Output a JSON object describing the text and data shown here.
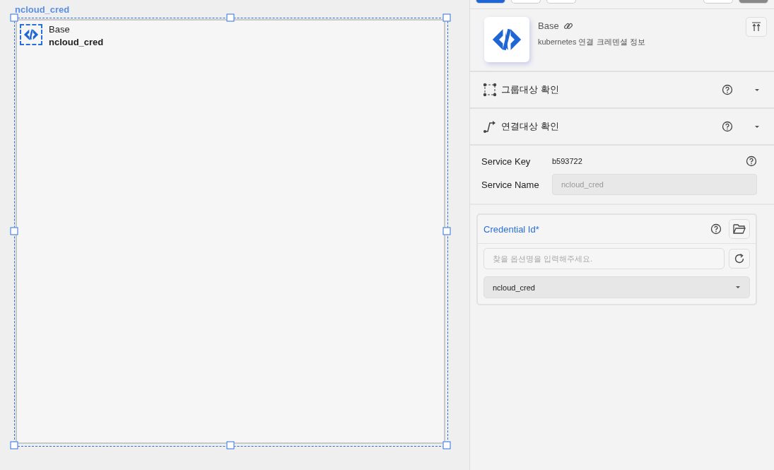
{
  "canvas": {
    "node_title": "ncloud_cred",
    "node": {
      "type": "Base",
      "name": "ncloud_cred",
      "selected": true
    }
  },
  "panel": {
    "header": {
      "title": "Base",
      "description": "kubernetes 연결 크레덴셜 정보"
    },
    "sections": [
      {
        "kind": "group",
        "label": "그룹대상 확인",
        "expanded": false
      },
      {
        "kind": "link",
        "label": "연결대상 확인",
        "expanded": false
      }
    ],
    "service": {
      "key_label": "Service Key",
      "key_value": "b593722",
      "name_label": "Service Name",
      "name_value": "ncloud_cred",
      "name_disabled": true
    },
    "credential": {
      "label": "Credential Id*",
      "search_placeholder": "찾을 옵션명을 입력해주세요.",
      "value": "ncloud_cred"
    }
  }
}
